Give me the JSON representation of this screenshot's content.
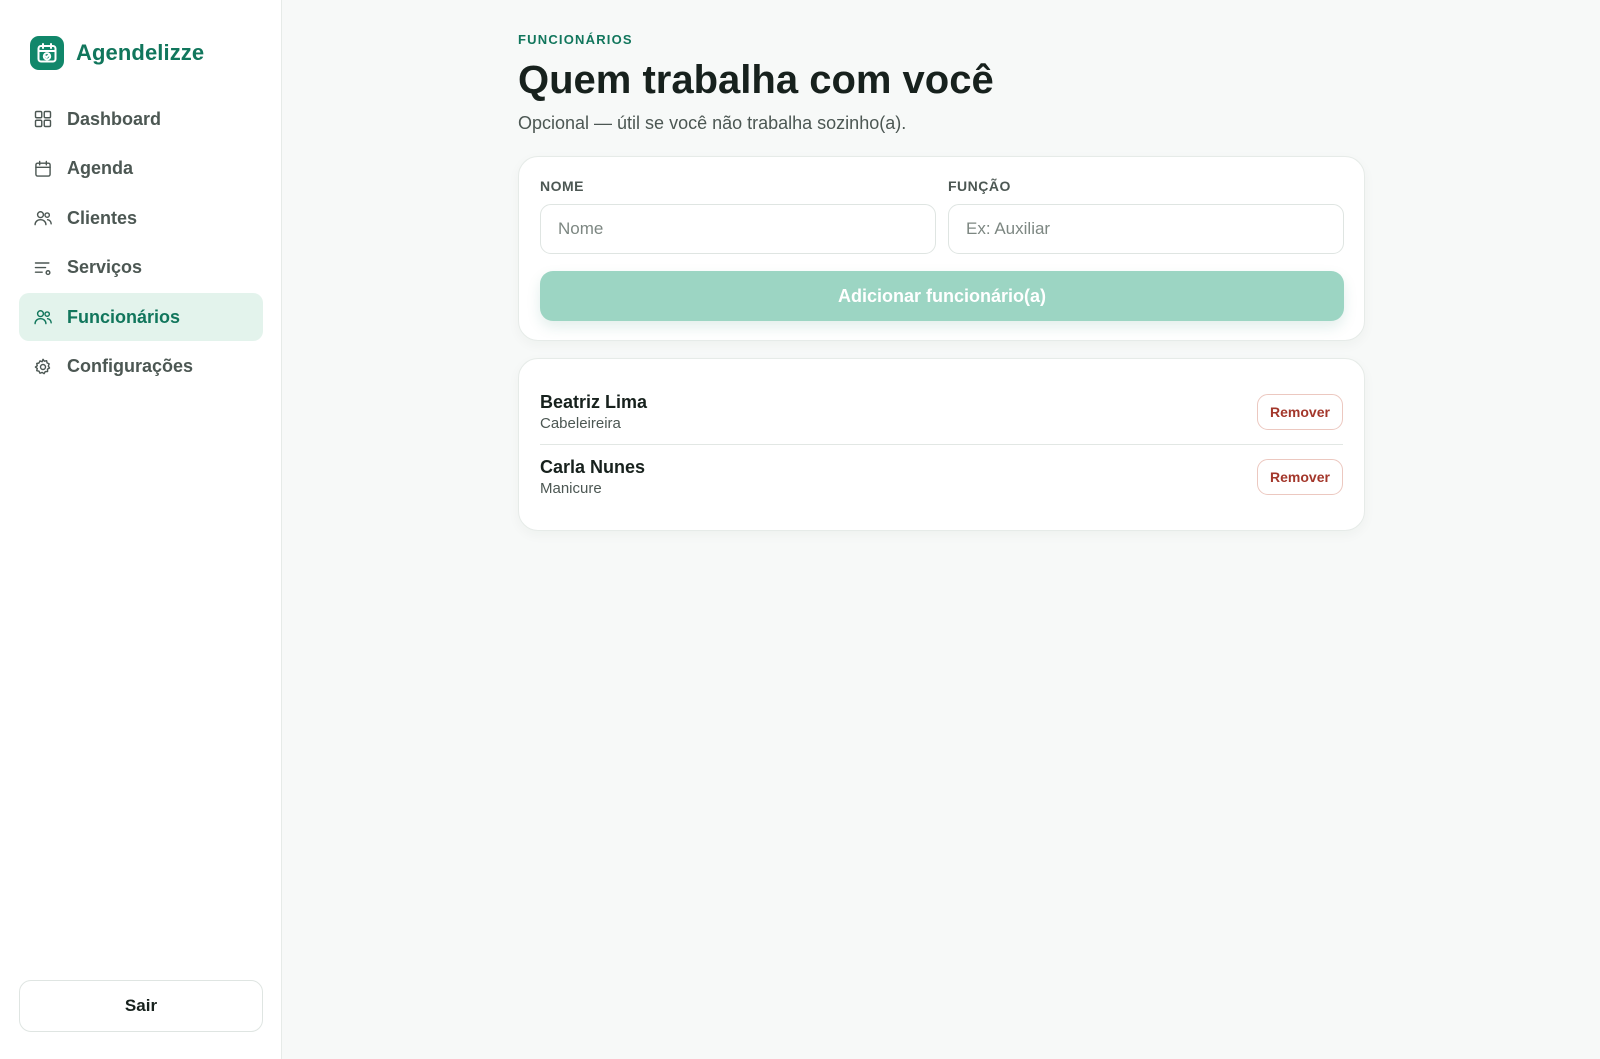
{
  "brand": {
    "name": "Agendelizze",
    "icon": "calendar-check-icon",
    "color": "#11876a"
  },
  "sidebar": {
    "items": [
      {
        "label": "Dashboard",
        "icon": "grid-icon",
        "active": false
      },
      {
        "label": "Agenda",
        "icon": "calendar-icon",
        "active": false
      },
      {
        "label": "Clientes",
        "icon": "users-icon",
        "active": false
      },
      {
        "label": "Serviços",
        "icon": "list-filter-icon",
        "active": false
      },
      {
        "label": "Funcionários",
        "icon": "users-icon",
        "active": true
      },
      {
        "label": "Configurações",
        "icon": "gear-icon",
        "active": false
      }
    ],
    "logout_label": "Sair"
  },
  "main": {
    "eyebrow": "FUNCIONÁRIOS",
    "title": "Quem trabalha com você",
    "subtitle": "Opcional — útil se você não trabalha sozinho(a).",
    "form": {
      "name_label": "NOME",
      "name_placeholder": "Nome",
      "name_value": "",
      "role_label": "FUNÇÃO",
      "role_placeholder": "Ex: Auxiliar",
      "role_value": "",
      "add_label": "Adicionar funcionário(a)"
    },
    "employees": [
      {
        "name": "Beatriz Lima",
        "role": "Cabeleireira",
        "remove_label": "Remover"
      },
      {
        "name": "Carla Nunes",
        "role": "Manicure",
        "remove_label": "Remover"
      }
    ]
  },
  "colors": {
    "accent": "#11765c",
    "active_bg": "#e3f3ec",
    "button_disabled": "#9cd5c3",
    "danger": "#a3372b"
  }
}
